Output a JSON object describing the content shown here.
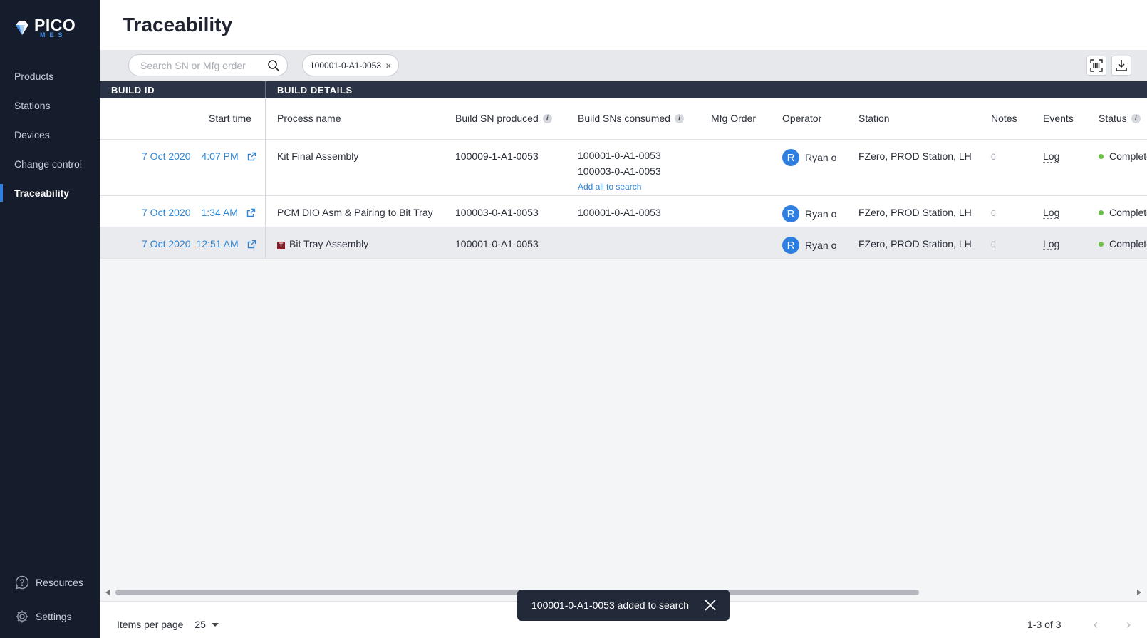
{
  "sidebar": {
    "logo_main": "PICO",
    "logo_sub": "MES",
    "items": [
      {
        "label": "Products"
      },
      {
        "label": "Stations"
      },
      {
        "label": "Devices"
      },
      {
        "label": "Change control"
      },
      {
        "label": "Traceability",
        "active": true
      }
    ],
    "resources_label": "Resources",
    "settings_label": "Settings"
  },
  "header": {
    "title": "Traceability"
  },
  "toolbar": {
    "search_placeholder": "Search SN or Mfg order",
    "search_value": "",
    "chip_label": "100001-0-A1-0053"
  },
  "table": {
    "group_headers": [
      "BUILD ID",
      "BUILD DETAILS"
    ],
    "columns": [
      "Start time",
      "Process name",
      "Build SN produced",
      "Build SNs consumed",
      "Mfg Order",
      "Operator",
      "Station",
      "Notes",
      "Events",
      "Status"
    ],
    "add_all_label": "Add all to search",
    "rows": [
      {
        "date": "7 Oct 2020",
        "time": "4:07 PM",
        "process": "Kit Final Assembly",
        "sn_produced": "100009-1-A1-0053",
        "sns_consumed": [
          "100001-0-A1-0053",
          "100003-0-A1-0053"
        ],
        "mfg_order": "",
        "operator_initial": "R",
        "operator": "Ryan o",
        "station": "FZero, PROD Station, LH",
        "notes": "0",
        "events": "Log",
        "status": "Complete"
      },
      {
        "date": "7 Oct 2020",
        "time": "1:34 AM",
        "process": "PCM DIO Asm & Pairing to Bit Tray",
        "sn_produced": "100003-0-A1-0053",
        "sns_consumed": [
          "100001-0-A1-0053"
        ],
        "mfg_order": "",
        "operator_initial": "R",
        "operator": "Ryan o",
        "station": "FZero, PROD Station, LH",
        "notes": "0",
        "events": "Log",
        "status": "Complete"
      },
      {
        "date": "7 Oct 2020",
        "time": "12:51 AM",
        "process_flag": "T",
        "process": "Bit Tray Assembly",
        "sn_produced": "100001-0-A1-0053",
        "sns_consumed": [],
        "mfg_order": "",
        "operator_initial": "R",
        "operator": "Ryan o",
        "station": "FZero, PROD Station, LH",
        "notes": "0",
        "events": "Log",
        "status": "Complete"
      }
    ]
  },
  "footer": {
    "items_per_page_label": "Items per page",
    "items_per_page_value": "25",
    "range": "1-3 of 3"
  },
  "toast": {
    "message": "100001-0-A1-0053 added to search"
  },
  "colors": {
    "sidebar_bg": "#151c2c",
    "accent": "#2f7fe0",
    "link": "#2f86d6",
    "header_bar": "#2b3447",
    "status_ok": "#6cc04a",
    "toast_bg": "#222a3a"
  }
}
